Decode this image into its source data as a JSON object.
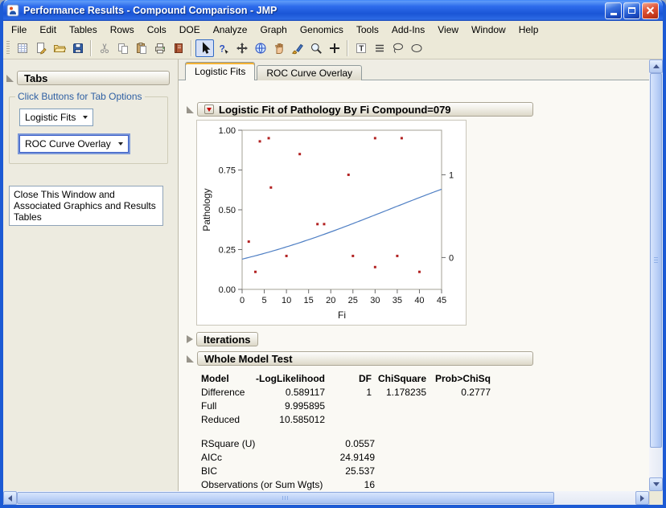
{
  "window": {
    "title": "Performance Results - Compound Comparison - JMP"
  },
  "menu": {
    "items": [
      "File",
      "Edit",
      "Tables",
      "Rows",
      "Cols",
      "DOE",
      "Analyze",
      "Graph",
      "Genomics",
      "Tools",
      "Add-Ins",
      "View",
      "Window",
      "Help"
    ]
  },
  "toolbar": {
    "selected": "arrow-tool",
    "groups": [
      [
        "new-data-table",
        "new-journal",
        "open-file",
        "save-file"
      ],
      [
        "cut",
        "copy",
        "paste",
        "print",
        "journal"
      ],
      [
        "arrow-tool",
        "help-tool",
        "grabber-tool",
        "globe-tool",
        "hand-tool",
        "brush-tool",
        "zoom-tool",
        "crosshair-tool"
      ],
      [
        "annotate-text-tool",
        "annotate-lines-tool",
        "lasso-tool",
        "oval-tool"
      ]
    ]
  },
  "sidebar": {
    "header": "Tabs",
    "group_label": "Click Buttons for Tab Options",
    "dropdowns": [
      "Logistic Fits",
      "ROC Curve Overlay"
    ],
    "close_button": "Close This Window and Associated Graphics and Results Tables"
  },
  "tabs": [
    {
      "label": "Logistic Fits",
      "active": true
    },
    {
      "label": "ROC Curve Overlay",
      "active": false
    }
  ],
  "report": {
    "fit_title": "Logistic Fit of Pathology By Fi Compound=079",
    "iterations_title": "Iterations",
    "whole_model_title": "Whole Model Test"
  },
  "whole_model": {
    "columns": [
      "Model",
      "-LogLikelihood",
      "DF",
      "ChiSquare",
      "Prob>ChiSq"
    ],
    "rows": [
      [
        "Difference",
        "0.589117",
        "1",
        "1.178235",
        "0.2777"
      ],
      [
        "Full",
        "9.995895",
        "",
        "",
        ""
      ],
      [
        "Reduced",
        "10.585012",
        "",
        "",
        ""
      ]
    ]
  },
  "stats": [
    {
      "label": "RSquare (U)",
      "value": "0.0557"
    },
    {
      "label": "AICc",
      "value": "24.9149"
    },
    {
      "label": "BIC",
      "value": "25.537"
    },
    {
      "label": "Observations (or Sum Wgts)",
      "value": "16"
    }
  ],
  "chart_data": {
    "type": "scatter",
    "title": "Logistic Fit of Pathology By Fi Compound=079",
    "xlabel": "Fi",
    "ylabel": "Pathology",
    "xlim": [
      0,
      45
    ],
    "ylim": [
      0,
      1
    ],
    "xticks": [
      0,
      5,
      10,
      15,
      20,
      25,
      30,
      35,
      40,
      45
    ],
    "yticks": [
      {
        "v": 0,
        "label": "0.00"
      },
      {
        "v": 0.25,
        "label": "0.25"
      },
      {
        "v": 0.5,
        "label": "0.50"
      },
      {
        "v": 0.75,
        "label": "0.75"
      },
      {
        "v": 1,
        "label": "1.00"
      }
    ],
    "points": [
      [
        4,
        0.93
      ],
      [
        6,
        0.95
      ],
      [
        13,
        0.85
      ],
      [
        6.5,
        0.64
      ],
      [
        24,
        0.72
      ],
      [
        17,
        0.41
      ],
      [
        18.5,
        0.41
      ],
      [
        1.5,
        0.3
      ],
      [
        10,
        0.21
      ],
      [
        25,
        0.21
      ],
      [
        35,
        0.21
      ],
      [
        3,
        0.11
      ],
      [
        30,
        0.14
      ],
      [
        40,
        0.11
      ],
      [
        30,
        0.95
      ],
      [
        36,
        0.95
      ]
    ],
    "curve": {
      "type": "logistic",
      "intercept": -1.45,
      "slope": 0.044
    },
    "right_axis_labels": [
      {
        "label": "1",
        "y": 0.72
      },
      {
        "label": "0",
        "y": 0.2
      }
    ],
    "grid": false,
    "legend": false,
    "point_color": "#b22222",
    "curve_color": "#4f7fc4"
  }
}
